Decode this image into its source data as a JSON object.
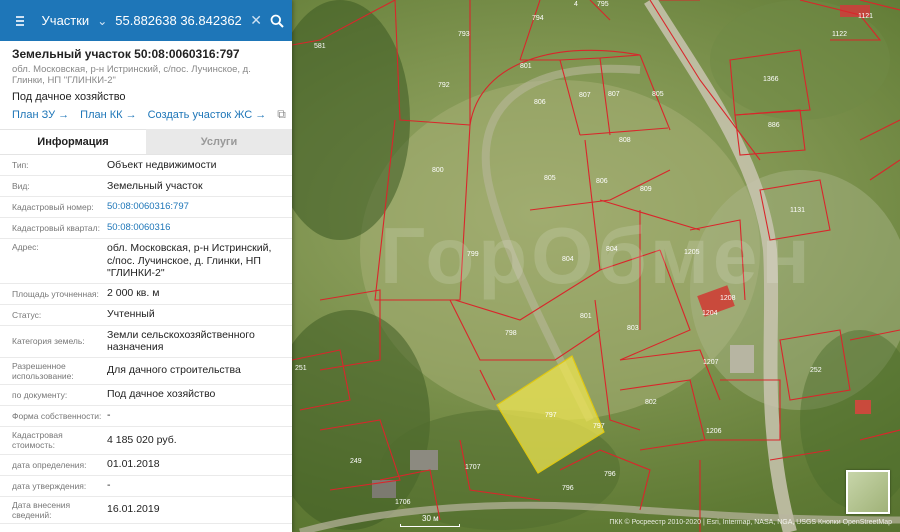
{
  "search": {
    "type_label": "Участки",
    "query": "55.882638 36.842362"
  },
  "plot": {
    "title": "Земельный участок 50:08:0060316:797",
    "address_short": "обл. Московская, р-н Истринский, с/пос. Лучинское, д. Глинки, НП \"ГЛИНКИ-2\"",
    "use": "Под дачное хозяйство",
    "links": [
      "План ЗУ",
      "План КК",
      "Создать участок ЖС"
    ]
  },
  "tabs": [
    "Информация",
    "Услуги"
  ],
  "info": [
    {
      "key": "Тип:",
      "value": "Объект недвижимости"
    },
    {
      "key": "Вид:",
      "value": "Земельный участок"
    },
    {
      "key": "Кадастровый номер:",
      "value": "50:08:0060316:797",
      "link": true
    },
    {
      "key": "Кадастровый квартал:",
      "value": "50:08:0060316",
      "link": true
    },
    {
      "key": "Адрес:",
      "value": "обл. Московская, р-н Истринский, с/пос. Лучинское, д. Глинки, НП \"ГЛИНКИ-2\""
    },
    {
      "key": "Площадь уточненная:",
      "value": "2 000 кв. м"
    },
    {
      "key": "Статус:",
      "value": "Учтенный"
    },
    {
      "key": "Категория земель:",
      "value": "Земли сельскохозяйственного назначения"
    },
    {
      "key": "Разрешенное использование:",
      "value": "Для дачного строительства"
    },
    {
      "key": "по документу:",
      "value": "Под дачное хозяйство"
    },
    {
      "key": "Форма собственности:",
      "value": "-"
    },
    {
      "key": "Кадастровая стоимость:",
      "value": "4 185 020 руб."
    },
    {
      "key": "дата определения:",
      "value": "01.01.2018"
    },
    {
      "key": "дата утверждения:",
      "value": "-"
    },
    {
      "key": "Дата внесения сведений:",
      "value": "16.01.2019"
    }
  ],
  "map": {
    "parcel_labels": [
      "794",
      "795",
      "1121",
      "1122",
      "793",
      "801",
      "1366",
      "792",
      "806",
      "807",
      "805",
      "886",
      "808",
      "800",
      "805",
      "809",
      "1131",
      "799",
      "804",
      "1205",
      "804",
      "1208",
      "1204",
      "798",
      "803",
      "251",
      "1207",
      "252",
      "797",
      "802",
      "1206",
      "249",
      "1707",
      "796",
      "796",
      "1706"
    ],
    "highlight_label": "797",
    "scale_label": "30 м",
    "attribution": "ПКК © Росреестр 2010-2020 | Esri, Intermap, NASA, NGA, USGS    Кнопки OpenStreetMap",
    "watermark": "ГорОбмен"
  },
  "colors": {
    "header_blue": "#1e76b8",
    "parcel_line": "#d9262b",
    "highlight_fill": "#f0e650"
  }
}
